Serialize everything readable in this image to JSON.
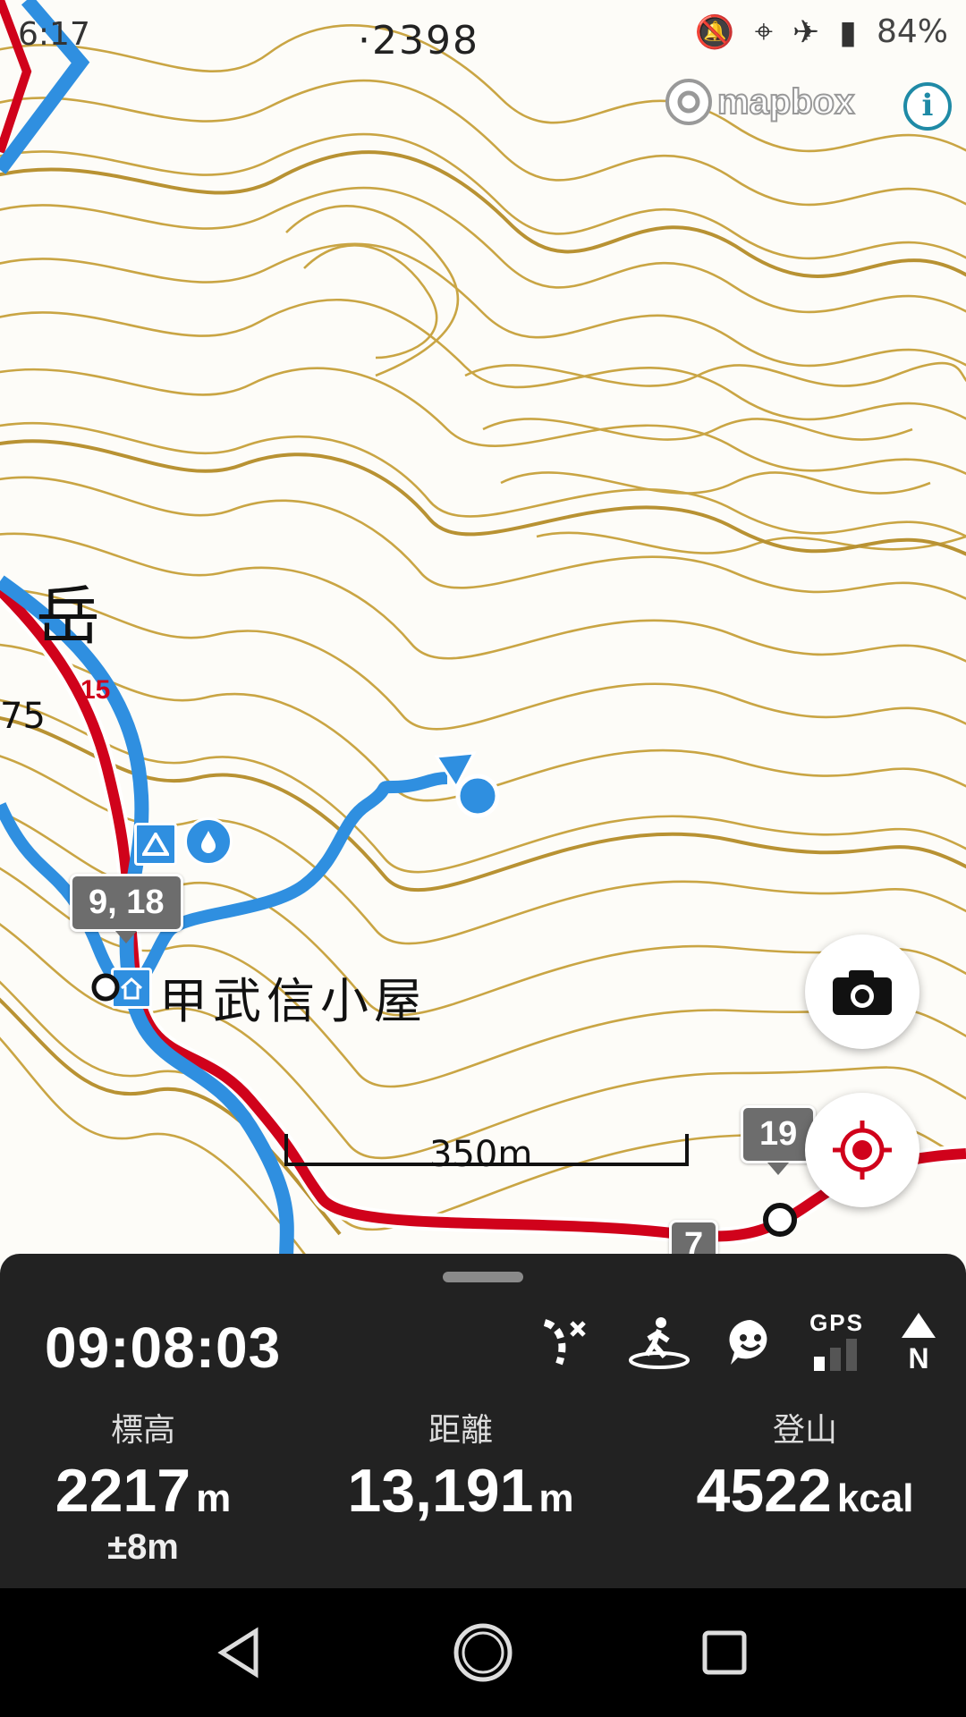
{
  "status_bar": {
    "time": "6:17",
    "battery": "84%"
  },
  "map": {
    "elevation_marker": "·2398",
    "attribution": "mapbox",
    "info": "i",
    "peak_name": "岳",
    "peak_elevation": "75",
    "route_number": "15",
    "hut_name": "甲武信小屋",
    "bubbles": [
      "9, 18",
      "19",
      "7"
    ],
    "scale_label": "350m"
  },
  "panel": {
    "clock": "09:08:03",
    "gps_label": "GPS",
    "stats": [
      {
        "label": "標高",
        "value": "2217",
        "unit": "m",
        "sub": "±8m"
      },
      {
        "label": "距離",
        "value": "13,191",
        "unit": "m"
      },
      {
        "label": "登山",
        "value": "4522",
        "unit": "kcal"
      }
    ]
  },
  "colors": {
    "contour": "#c9a544",
    "route_red": "#d0021b",
    "track_blue": "#2f8fe0",
    "panel": "#222222"
  }
}
